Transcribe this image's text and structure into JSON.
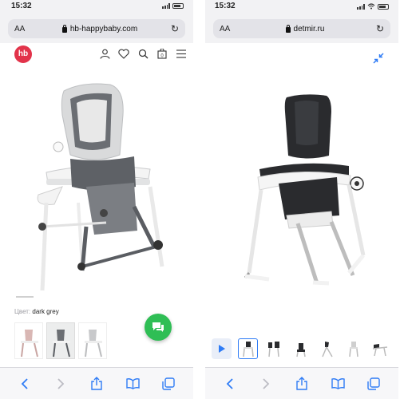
{
  "left": {
    "status": {
      "time": "15:32"
    },
    "address": {
      "aa": "AA",
      "url": "hb-happybaby.com"
    },
    "header": {
      "logo": "hb"
    },
    "product": {
      "color_label": "Цвет:",
      "color_value": "dark grey"
    },
    "toolbar": [
      "back",
      "forward",
      "share",
      "bookmarks",
      "tabs"
    ]
  },
  "right": {
    "status": {
      "time": "15:32"
    },
    "address": {
      "aa": "AA",
      "url": "detmir.ru"
    },
    "toolbar": [
      "back",
      "forward",
      "share",
      "bookmarks",
      "tabs"
    ]
  },
  "colors": {
    "accent": "#2f7cf6",
    "brand_hb": "#e2334a",
    "chat_green": "#2fbe55",
    "chair_dark": "#5a5d62",
    "chair_black": "#2a2b2e"
  }
}
